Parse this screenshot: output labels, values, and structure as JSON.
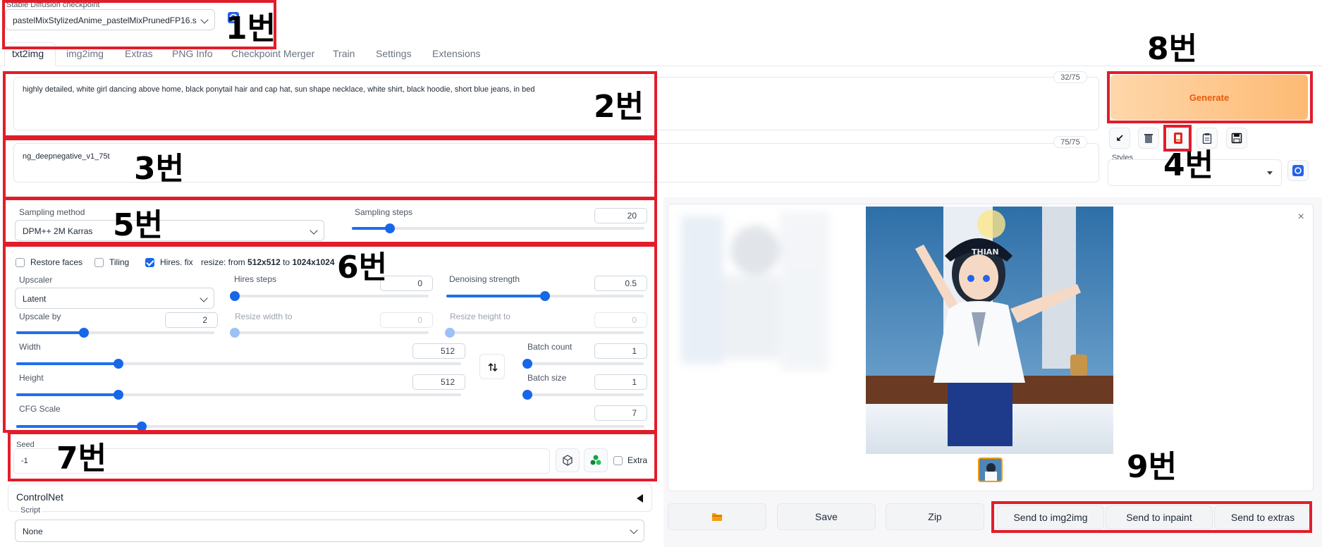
{
  "checkpoint": {
    "label": "Stable Diffusion checkpoint",
    "value": "pastelMixStylizedAnime_pastelMixPrunedFP16.s"
  },
  "tabs": [
    "txt2img",
    "img2img",
    "Extras",
    "PNG Info",
    "Checkpoint Merger",
    "Train",
    "Settings",
    "Extensions"
  ],
  "prompt": {
    "text": "highly detailed, white girl  dancing above home, black ponytail hair and cap hat, sun shape necklace, white shirt,  black hoodie, short blue jeans, in bed",
    "token_count": "32/75"
  },
  "negative_prompt": {
    "text": "ng_deepnegative_v1_75t",
    "token_count": "75/75"
  },
  "generate_label": "Generate",
  "styles_label": "Styles",
  "sampling": {
    "method_label": "Sampling method",
    "method_value": "DPM++ 2M Karras",
    "steps_label": "Sampling steps",
    "steps_value": "20",
    "steps_fraction": 0.13
  },
  "hires": {
    "restore_faces": "Restore faces",
    "tiling": "Tiling",
    "hires_fix": "Hires. fix",
    "resize_prefix": "resize: from",
    "resize_from": "512x512",
    "resize_to_word": "to",
    "resize_to": "1024x1024",
    "upscaler_label": "Upscaler",
    "upscaler_value": "Latent",
    "hires_steps_label": "Hires steps",
    "hires_steps_value": "0",
    "hires_steps_fraction": 0.0,
    "denoising_label": "Denoising strength",
    "denoising_value": "0.5",
    "denoising_fraction": 0.5,
    "upscale_by_label": "Upscale by",
    "upscale_by_value": "2",
    "upscale_by_fraction": 0.34,
    "resize_width_label": "Resize width to",
    "resize_width_value": "0",
    "resize_height_label": "Resize height to",
    "resize_height_value": "0"
  },
  "size": {
    "width_label": "Width",
    "width_value": "512",
    "width_fraction": 0.23,
    "height_label": "Height",
    "height_value": "512",
    "height_fraction": 0.23,
    "batch_count_label": "Batch count",
    "batch_count_value": "1",
    "batch_size_label": "Batch size",
    "batch_size_value": "1",
    "cfg_label": "CFG Scale",
    "cfg_value": "7",
    "cfg_fraction": 0.2
  },
  "seed": {
    "label": "Seed",
    "value": "-1",
    "extra_label": "Extra"
  },
  "controlnet_label": "ControlNet",
  "script": {
    "label": "Script",
    "value": "None"
  },
  "output_buttons": {
    "save": "Save",
    "zip": "Zip",
    "send_img2img": "Send to img2img",
    "send_inpaint": "Send to inpaint",
    "send_extras": "Send to extras"
  },
  "cap_text": "THIAN",
  "annotations": [
    "1번",
    "2번",
    "3번",
    "4번",
    "5번",
    "6번",
    "7번",
    "8번",
    "9번"
  ],
  "colors": {
    "accent_blue": "#1767e8",
    "generate_orange": "#fdba74",
    "generate_text": "#ea580c",
    "annotation_red": "#e11d2a"
  },
  "icons": [
    "refresh-icon",
    "arrow-icon",
    "trash-icon",
    "red-card-icon",
    "clipboard-icon",
    "save-disk-icon",
    "swap-icon",
    "dice-icon",
    "recycle-icon",
    "folder-icon",
    "close-icon",
    "chevron-down-icon",
    "caret-left-icon"
  ]
}
